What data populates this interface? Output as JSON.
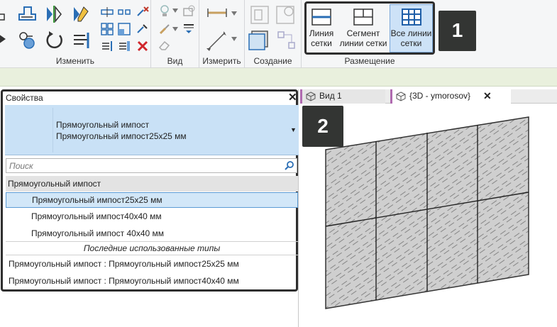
{
  "ribbon": {
    "groups": {
      "modify_label": "Изменить",
      "view_label": "Вид",
      "measure_label": "Измерить",
      "create_label": "Создание",
      "placement_label": "Размещение"
    },
    "placement_buttons": [
      {
        "line1": "Линия",
        "line2": "сетки"
      },
      {
        "line1": "Сегмент",
        "line2": "линии сетки"
      },
      {
        "line1": "Все линии",
        "line2": "сетки"
      }
    ]
  },
  "badges": {
    "one": "1",
    "two": "2"
  },
  "properties": {
    "title": "Свойства",
    "close": "✕",
    "type_family": "Прямоугольный импост",
    "type_name": "Прямоугольный импост25x25 мм",
    "search_placeholder": "Поиск",
    "group_header": "Прямоугольный импост",
    "items": [
      "Прямоугольный импост25x25 мм",
      "Прямоугольный импост40x40 мм",
      "Прямоугольный импост 40x40 мм"
    ],
    "recent_header": "Последние использованные типы",
    "recent": [
      "Прямоугольный импост : Прямоугольный импост25x25 мм",
      "Прямоугольный импост : Прямоугольный импост40x40 мм"
    ]
  },
  "tabs": [
    {
      "label": "Вид 1"
    },
    {
      "label": "{3D - ymorosov}",
      "close": "✕"
    }
  ],
  "colors": {
    "accent": "#c9e1f6",
    "selected": "#d2e7f8",
    "badge": "#333533",
    "tab_marker": "#b06ab0"
  }
}
